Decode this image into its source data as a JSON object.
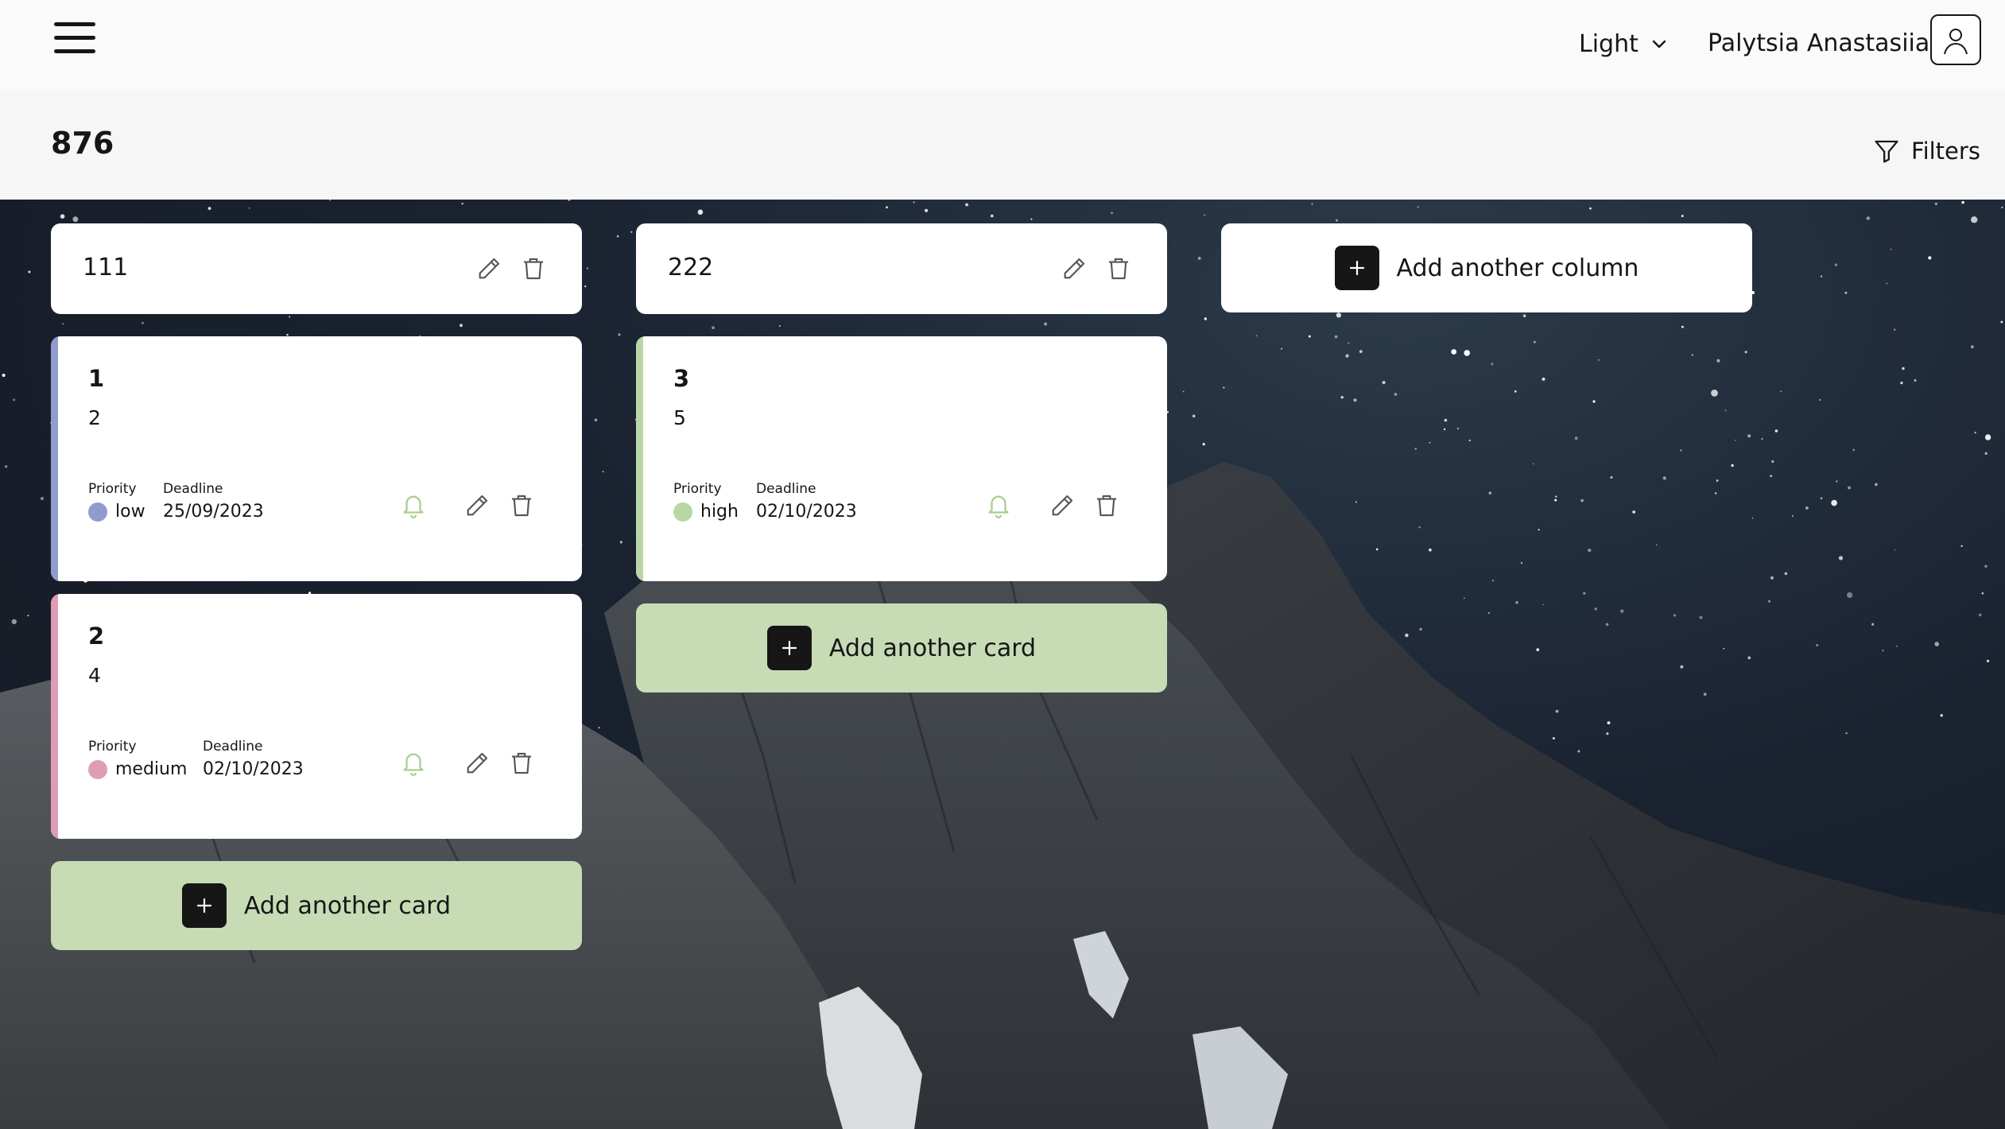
{
  "header": {
    "menu_icon": "hamburger-menu-icon",
    "theme": {
      "selected": "Light",
      "icon": "chevron-down-icon"
    },
    "user": {
      "name": "Palytsia Anastasiia",
      "avatar_icon": "user-avatar-icon"
    }
  },
  "board": {
    "title": "876",
    "filters_label": "Filters",
    "filters_icon": "funnel-icon"
  },
  "colors": {
    "low": "#909ccd",
    "medium": "#e09cb5",
    "high": "#b8d7a5",
    "add_card_bg": "#c7dbb5",
    "bell": "#a7cf8f"
  },
  "columns": [
    {
      "title": "111",
      "cards": [
        {
          "title": "1",
          "description": "2",
          "priority_label": "Priority",
          "priority": "low",
          "deadline_label": "Deadline",
          "deadline": "25/09/2023"
        },
        {
          "title": "2",
          "description": "4",
          "priority_label": "Priority",
          "priority": "medium",
          "deadline_label": "Deadline",
          "deadline": "02/10/2023"
        }
      ],
      "add_card_label": "Add another card"
    },
    {
      "title": "222",
      "cards": [
        {
          "title": "3",
          "description": "5",
          "priority_label": "Priority",
          "priority": "high",
          "deadline_label": "Deadline",
          "deadline": "02/10/2023"
        }
      ],
      "add_card_label": "Add another card"
    }
  ],
  "add_column_label": "Add another column",
  "icons": {
    "edit": "pencil-icon",
    "delete": "trash-icon",
    "notify": "bell-icon",
    "add": "plus-icon"
  }
}
